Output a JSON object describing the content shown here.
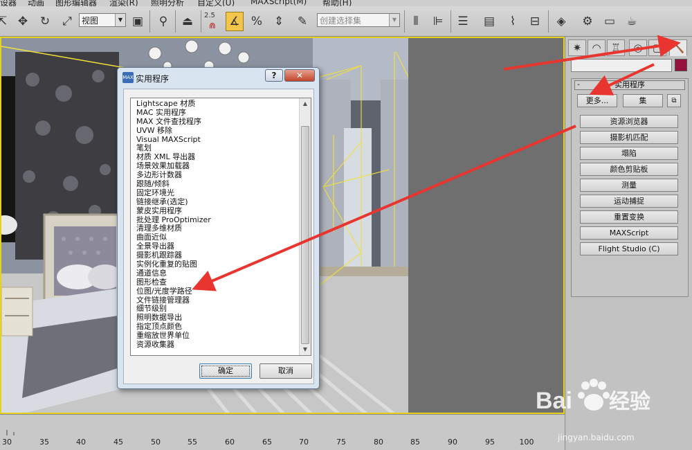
{
  "menubar": {
    "items": [
      "没设器",
      "动画",
      "图形编辑器",
      "渲染(R)",
      "照明分析",
      "自定义(U)",
      "MAXScript(M)",
      "帮助(H)"
    ]
  },
  "toolbar": {
    "view_combo": "视图",
    "snap_value": "2.5",
    "selection_set_placeholder": "创建选择集"
  },
  "command_panel": {
    "rollout_title": "实用程序",
    "more_button": "更多...",
    "sets_button": "集",
    "utilities": [
      "资源浏览器",
      "摄影机匹配",
      "塌陷",
      "颜色剪贴板",
      "测量",
      "运动捕捉",
      "重置变换",
      "MAXScript",
      "Flight Studio (C)"
    ],
    "color_swatch": "#96123a"
  },
  "dialog": {
    "title": "实用程序",
    "icon_text": "MAX",
    "help_button": "?",
    "close_button": "✕",
    "items": [
      "Lightscape 材质",
      "MAC 实用程序",
      "MAX 文件查找程序",
      "UVW 移除",
      "Visual MAXScript",
      "笔划",
      "材质 XML 导出器",
      "场景效果加载器",
      "多边形计数器",
      "跟随/倾斜",
      "固定环境光",
      "链接继承(选定)",
      "蒙皮实用程序",
      "批处理 ProOptimizer",
      "清理多维材质",
      "曲面近似",
      "全景导出器",
      "摄影机跟踪器",
      "实例化重复的贴图",
      "通道信息",
      "图形检查",
      "位图/光度学路径",
      "文件链接管理器",
      "细节级别",
      "照明数据导出",
      "指定顶点颜色",
      "重缩放世界单位",
      "资源收集器"
    ],
    "ok_button": "确定",
    "cancel_button": "取消"
  },
  "ruler": {
    "ticks": [
      "30",
      "35",
      "40",
      "45",
      "50",
      "55",
      "60",
      "65",
      "70",
      "75",
      "80",
      "85",
      "90",
      "95",
      "100"
    ]
  },
  "watermark": {
    "brand": "Bai 经验",
    "url": "jingyan.baidu.com"
  },
  "accent_colors": {
    "arrow": "#e8352f",
    "active_viewport_border": "#e4d21c",
    "active_tool": "#f2c64b"
  }
}
